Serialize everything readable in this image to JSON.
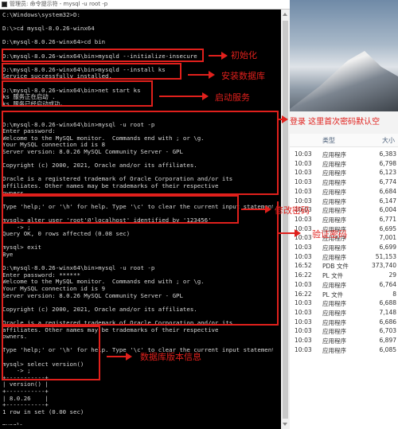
{
  "console": {
    "title": "管理员: 命令提示符 - mysql -u root -p",
    "lines": [
      "C:\\Windows\\system32>D:",
      "",
      "D:\\>cd mysql-8.0.26-winx64",
      "",
      "D:\\mysql-8.0.26-winx64>cd bin",
      "",
      "D:\\mysql-8.0.26-winx64\\bin>mysqld --initialize-insecure",
      "",
      "D:\\mysql-8.0.26-winx64\\bin>mysqld --install ks",
      "Service successfully installed.",
      "",
      "D:\\mysql-8.0.26-winx64\\bin>net start ks",
      "ks 服务正在启动 .",
      "ks 服务已经启动成功。",
      "",
      "",
      "D:\\mysql-8.0.26-winx64\\bin>mysql -u root -p",
      "Enter password:",
      "Welcome to the MySQL monitor.  Commands end with ; or \\g.",
      "Your MySQL connection id is 8",
      "Server version: 8.0.26 MySQL Community Server - GPL",
      "",
      "Copyright (c) 2000, 2021, Oracle and/or its affiliates.",
      "",
      "Oracle is a registered trademark of Oracle Corporation and/or its",
      "affiliates. Other names may be trademarks of their respective",
      "owners.",
      "",
      "Type 'help;' or '\\h' for help. Type '\\c' to clear the current input statement.",
      "",
      "mysql> alter user 'root'@'localhost' identified by '123456'",
      "    -> ;",
      "Query OK, 0 rows affected (0.08 sec)",
      "",
      "mysql> exit",
      "Bye",
      "",
      "D:\\mysql-8.0.26-winx64\\bin>mysql -u root -p",
      "Enter password: ******",
      "Welcome to the MySQL monitor.  Commands end with ; or \\g.",
      "Your MySQL connection id is 9",
      "Server version: 8.0.26 MySQL Community Server - GPL",
      "",
      "Copyright (c) 2000, 2021, Oracle and/or its affiliates.",
      "",
      "Oracle is a registered trademark of Oracle Corporation and/or its",
      "affiliates. Other names may be trademarks of their respective",
      "owners.",
      "",
      "Type 'help;' or '\\h' for help. Type '\\c' to clear the current input statement.",
      "",
      "mysql> select version()",
      "    -> ;",
      "+-----------+",
      "| version() |",
      "+-----------+",
      "| 8.0.26    |",
      "+-----------+",
      "1 row in set (0.00 sec)",
      "",
      "mysql>"
    ]
  },
  "annotations": {
    "init": "初始化",
    "install": "安装数据库",
    "start": "启动服务",
    "login": "登录 这里首次密码默认空",
    "change_pw": "修改密码",
    "verify_pw": "验证密码",
    "version": "数据库版本信息"
  },
  "explorer": {
    "col_type": "类型",
    "col_size": "大小",
    "rows": [
      {
        "time": "10:03",
        "type": "应用程序",
        "size": "6,383"
      },
      {
        "time": "10:03",
        "type": "应用程序",
        "size": "6,798"
      },
      {
        "time": "10:03",
        "type": "应用程序",
        "size": "6,123"
      },
      {
        "time": "10:03",
        "type": "应用程序",
        "size": "6,774"
      },
      {
        "time": "10:03",
        "type": "应用程序",
        "size": "6,684"
      },
      {
        "time": "10:03",
        "type": "应用程序",
        "size": "6,147"
      },
      {
        "time": "10:03",
        "type": "应用程序",
        "size": "6,004"
      },
      {
        "time": "10:03",
        "type": "应用程序",
        "size": "6,771"
      },
      {
        "time": "10:03",
        "type": "应用程序",
        "size": "6,695"
      },
      {
        "time": "10:03",
        "type": "应用程序",
        "size": "7,001"
      },
      {
        "time": "10:03",
        "type": "应用程序",
        "size": "6,699"
      },
      {
        "time": "10:03",
        "type": "应用程序",
        "size": "51,153"
      },
      {
        "time": "16:52",
        "type": "PDB 文件",
        "size": "373,740"
      },
      {
        "time": "16:22",
        "type": "PL 文件",
        "size": "29"
      },
      {
        "time": "10:03",
        "type": "应用程序",
        "size": "6,764"
      },
      {
        "time": "16:22",
        "type": "PL 文件",
        "size": "8"
      },
      {
        "time": "10:03",
        "type": "应用程序",
        "size": "6,688"
      },
      {
        "time": "10:03",
        "type": "应用程序",
        "size": "7,148"
      },
      {
        "time": "10:03",
        "type": "应用程序",
        "size": "6,686"
      },
      {
        "time": "10:03",
        "type": "应用程序",
        "size": "6,703"
      },
      {
        "time": "10:03",
        "type": "应用程序",
        "size": "6,897"
      },
      {
        "time": "10:03",
        "type": "应用程序",
        "size": "6,085"
      }
    ]
  }
}
